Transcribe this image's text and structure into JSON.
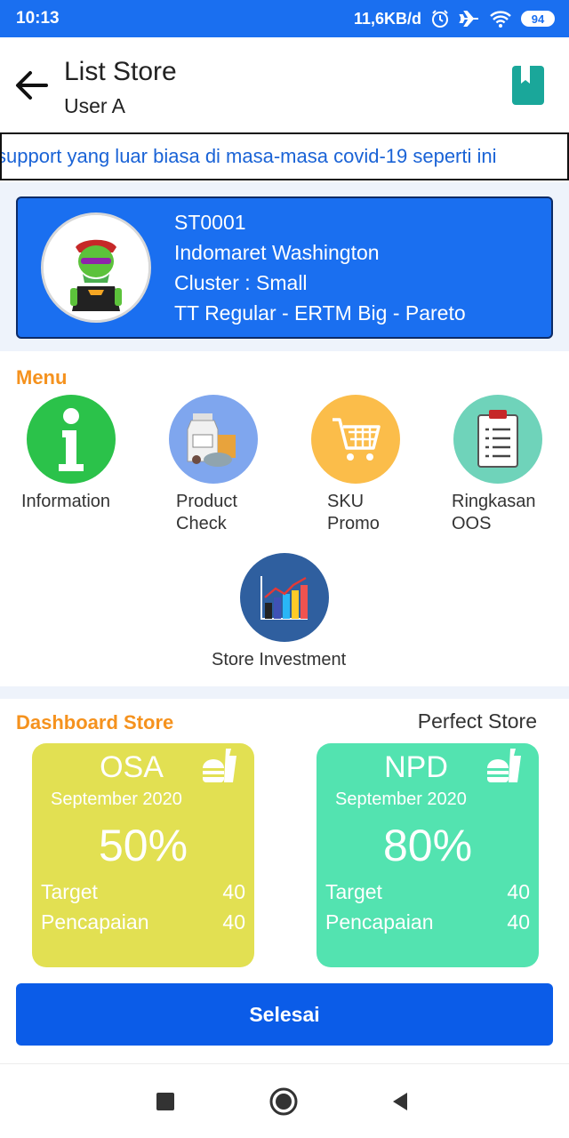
{
  "status_bar": {
    "time": "10:13",
    "network_speed": "11,6KB/d",
    "battery": "94",
    "icons": [
      "alarm-icon",
      "airplane-icon",
      "wifi-icon",
      "battery-icon"
    ]
  },
  "app_bar": {
    "title": "List Store",
    "subtitle": "User A",
    "icons": [
      "back-arrow-icon",
      "bookmark-icon"
    ]
  },
  "marquee": {
    "text": "support yang luar biasa di masa-masa covid-19 seperti ini"
  },
  "store": {
    "code": "ST0001",
    "name": "Indomaret Washington",
    "cluster": "Cluster : Small",
    "type": "TT Regular - ERTM Big - Pareto"
  },
  "menu": {
    "label": "Menu",
    "items": [
      {
        "label_1": "Information",
        "label_2": "",
        "icon": "info-icon",
        "color": "#2bc24a"
      },
      {
        "label_1": "Product",
        "label_2": "Check",
        "icon": "milk-bottle-icon",
        "color": "#7fa6ee"
      },
      {
        "label_1": "SKU",
        "label_2": "Promo",
        "icon": "shopping-cart-icon",
        "color": "#fbbd4a"
      },
      {
        "label_1": "Ringkasan",
        "label_2": "OOS",
        "icon": "clipboard-icon",
        "color": "#6fd3ba"
      },
      {
        "label_1": "Store Investment",
        "label_2": "",
        "icon": "bar-chart-icon",
        "color": "#2f5f9f"
      }
    ]
  },
  "dashboard": {
    "label": "Dashboard Store",
    "perfect_store": "Perfect Store",
    "cards": [
      {
        "title": "OSA",
        "period": "September 2020",
        "percent": "50%",
        "target_label": "Target",
        "target_value": "40",
        "achievement_label": "Pencapaian",
        "achievement_value": "40",
        "color": "#e2e052",
        "icon": "food-drink-icon"
      },
      {
        "title": "NPD",
        "period": "September 2020",
        "percent": "80%",
        "target_label": "Target",
        "target_value": "40",
        "achievement_label": "Pencapaian",
        "achievement_value": "40",
        "color": "#53e3b0",
        "icon": "food-drink-icon"
      }
    ],
    "done_button": "Selesai"
  },
  "nav_bar": {
    "icons": [
      "recent-apps-icon",
      "home-icon",
      "back-icon"
    ]
  },
  "colors": {
    "primary": "#1a6ff0",
    "accent_orange": "#f5921e",
    "button_blue": "#0b5ce8"
  }
}
